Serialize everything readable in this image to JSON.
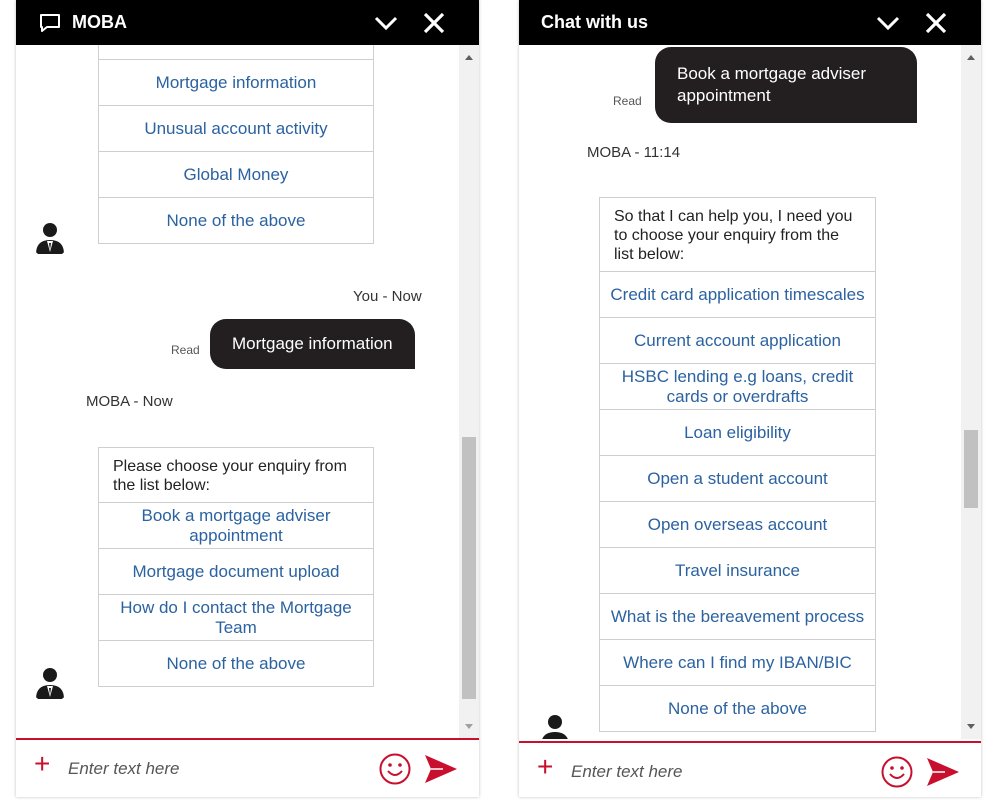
{
  "left": {
    "header": {
      "title": "MOBA"
    },
    "top_list": {
      "options": [
        "Mortgage information",
        "Unusual account activity",
        "Global Money",
        "None of the above"
      ]
    },
    "user_meta": "You - Now",
    "read_label": "Read",
    "user_bubble": "Mortgage information",
    "bot_meta": "MOBA - Now",
    "bottom_list": {
      "prompt": "Please choose your enquiry from the list below:",
      "options": [
        "Book a mortgage adviser appointment",
        "Mortgage document upload",
        "How do I contact the Mortgage Team",
        "None of the above"
      ]
    },
    "input": {
      "placeholder": "Enter text here"
    }
  },
  "right": {
    "header": {
      "title": "Chat with us"
    },
    "read_label": "Read",
    "user_bubble": "Book a mortgage adviser appointment",
    "bot_meta": "MOBA - 11:14",
    "list": {
      "prompt": "So that I can help you, I need you to choose your enquiry from the list below:",
      "options": [
        "Credit card application timescales",
        "Current account application",
        "HSBC lending e.g loans, credit cards or overdrafts",
        "Loan eligibility",
        "Open a student account",
        "Open overseas account",
        "Travel insurance",
        "What is the bereavement process",
        "Where can I find my IBAN/BIC",
        "None of the above"
      ]
    },
    "input": {
      "placeholder": "Enter text here"
    }
  },
  "colors": {
    "header_bg": "#000000",
    "accent_red": "#c8102e",
    "link_blue": "#2b62a0",
    "bubble_bg": "#231f20"
  },
  "icons": [
    "chat-bubble-icon",
    "chevron-down-icon",
    "close-icon",
    "avatar-icon",
    "plus-icon",
    "emoji-icon",
    "send-icon"
  ]
}
